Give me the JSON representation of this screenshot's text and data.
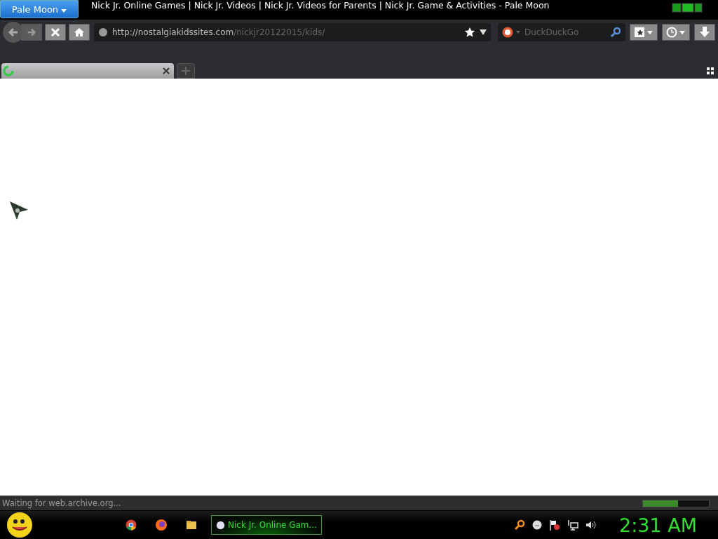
{
  "app_menu": {
    "label": "Pale Moon"
  },
  "window": {
    "title": "Nick Jr. Online Games | Nick Jr. Videos | Nick Jr. Videos for Parents | Nick Jr. Game & Activities - Pale Moon"
  },
  "url": {
    "host": "http://nostalgiakidssites.com",
    "path": "/nickjr20122015/kids/"
  },
  "search": {
    "placeholder": "DuckDuckGo"
  },
  "tabs": [
    {
      "loading": true,
      "selected": true
    }
  ],
  "status_bar": {
    "text": "Waiting for web.archive.org...",
    "progress": {
      "level": 0.53
    }
  },
  "taskbar": {
    "buttons": [
      {
        "label": "Nick Jr. Online Gam...",
        "selected": true
      }
    ],
    "clock": "2:31 AM"
  }
}
